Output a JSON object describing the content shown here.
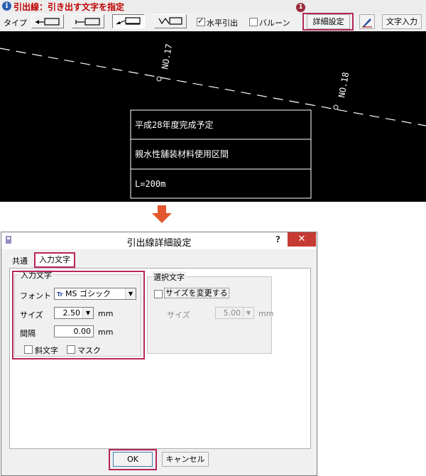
{
  "command": {
    "title": "引出線：引き出す文字を指定",
    "type_label": "タイプ",
    "horizontal_leader_label": "水平引出",
    "balloon_label": "バルーン",
    "detail_settings_button": "詳細設定",
    "text_input_button": "文字入力",
    "badge_number": "1"
  },
  "canvas": {
    "station_labels": [
      "NO.17",
      "NO.18"
    ],
    "note_rows": [
      "平成28年度完成予定",
      "親水性舗装材料使用区間",
      "L=200m"
    ]
  },
  "dialog": {
    "title": "引出線詳細設定",
    "help": "?",
    "close": "✕",
    "tabs": [
      "共通",
      "入力文字"
    ],
    "input_group": {
      "title": "入力文字",
      "font_label": "フォント",
      "font_value": "MS ゴシック",
      "font_icon": "Tr",
      "size_label": "サイズ",
      "size_value": "2.50",
      "size_unit": "mm",
      "spacing_label": "間隔",
      "spacing_value": "0.00",
      "spacing_unit": "mm",
      "italic_label": "斜文字",
      "mask_label": "マスク"
    },
    "select_group": {
      "title": "選択文字",
      "change_size_label": "サイズを変更する",
      "size_label": "サイズ",
      "size_value": "5.00",
      "size_unit": "mm"
    },
    "ok_button": "OK",
    "cancel_button": "キャンセル"
  },
  "colors": {
    "highlight": "#b5265c",
    "arrow": "#e4572e",
    "close_button": "#c73a32"
  }
}
